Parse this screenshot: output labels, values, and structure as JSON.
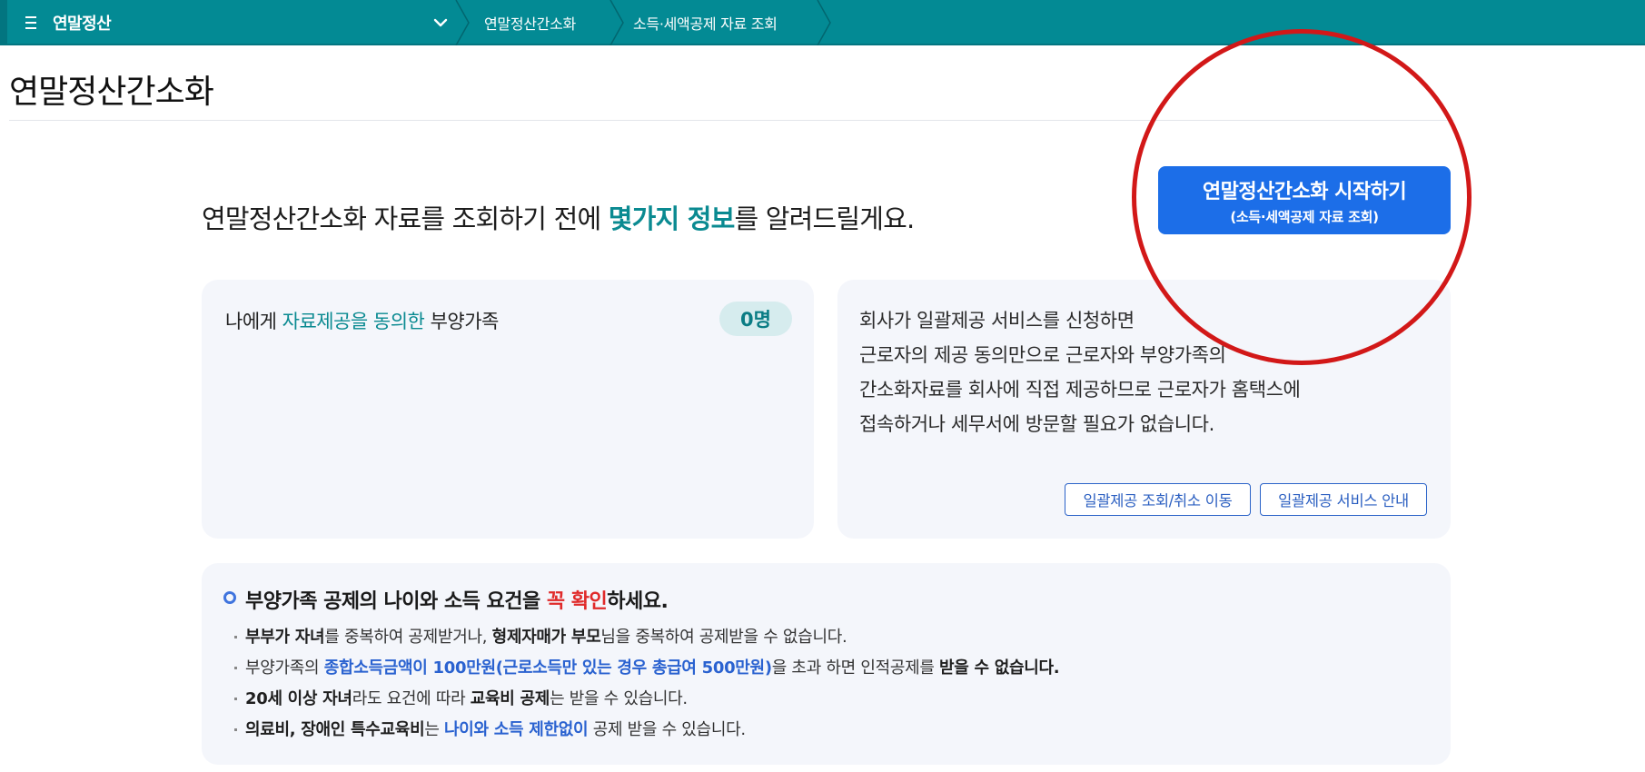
{
  "nav": {
    "root": "연말정산",
    "breadcrumbs": [
      "연말정산간소화",
      "소득·세액공제 자료 조회"
    ]
  },
  "page": {
    "title": "연말정산간소화"
  },
  "intro": {
    "before": "연말정산간소화 자료를 조회하기 전에 ",
    "highlight": "몇가지 정보",
    "after": "를 알려드릴게요."
  },
  "start_button": {
    "main": "연말정산간소화 시작하기",
    "sub": "(소득·세액공제 자료 조회)"
  },
  "dependents_card": {
    "label_prefix": "나에게 ",
    "label_highlight": "자료제공을 동의한",
    "label_suffix": " 부양가족",
    "count": "0명"
  },
  "batch_card": {
    "lines": [
      "회사가 일괄제공 서비스를 신청하면",
      "근로자의 제공 동의만으로 근로자와 부양가족의",
      "간소화자료를 회사에 직접 제공하므로 근로자가 홈택스에",
      "접속하거나 세무서에 방문할 필요가 없습니다."
    ],
    "buttons": [
      "일괄제공 조회/취소 이동",
      "일괄제공 서비스 안내"
    ]
  },
  "notice": {
    "head_before": "부양가족 공제의 나이와 소득 요건을 ",
    "head_red": "꼭 확인",
    "head_after": "하세요.",
    "bullets": [
      [
        {
          "t": "부부가 자녀",
          "s": "b"
        },
        {
          "t": "를 중복하여 공제받거나, ",
          "s": ""
        },
        {
          "t": "형제자매가 부모",
          "s": "b"
        },
        {
          "t": "님을 중복하여 공제받을 수 없습니다.",
          "s": ""
        }
      ],
      [
        {
          "t": "부양가족의 ",
          "s": ""
        },
        {
          "t": "종합소득금액이 100만원(근로소득만 있는 경우 총급여 500만원)",
          "s": "blue"
        },
        {
          "t": "을 초과 하면 인적공제를 ",
          "s": ""
        },
        {
          "t": "받을 수 없습니다.",
          "s": "b"
        }
      ],
      [
        {
          "t": "20세 이상 자녀",
          "s": "b"
        },
        {
          "t": "라도 요건에 따라 ",
          "s": ""
        },
        {
          "t": "교육비 공제",
          "s": "b"
        },
        {
          "t": "는 받을 수 있습니다.",
          "s": ""
        }
      ],
      [
        {
          "t": "의료비, 장애인 특수교육비",
          "s": "b"
        },
        {
          "t": "는 ",
          "s": ""
        },
        {
          "t": "나이와 소득 제한없이",
          "s": "blue"
        },
        {
          "t": " 공제 받을 수 있습니다.",
          "s": ""
        }
      ]
    ]
  },
  "colors": {
    "nav_bg": "#038a94",
    "accent_teal": "#0a8a91",
    "primary_button": "#1c6ee8",
    "annotation_circle": "#d21818",
    "emphasis_red": "#e02a2a",
    "emphasis_blue": "#2a62d0"
  }
}
